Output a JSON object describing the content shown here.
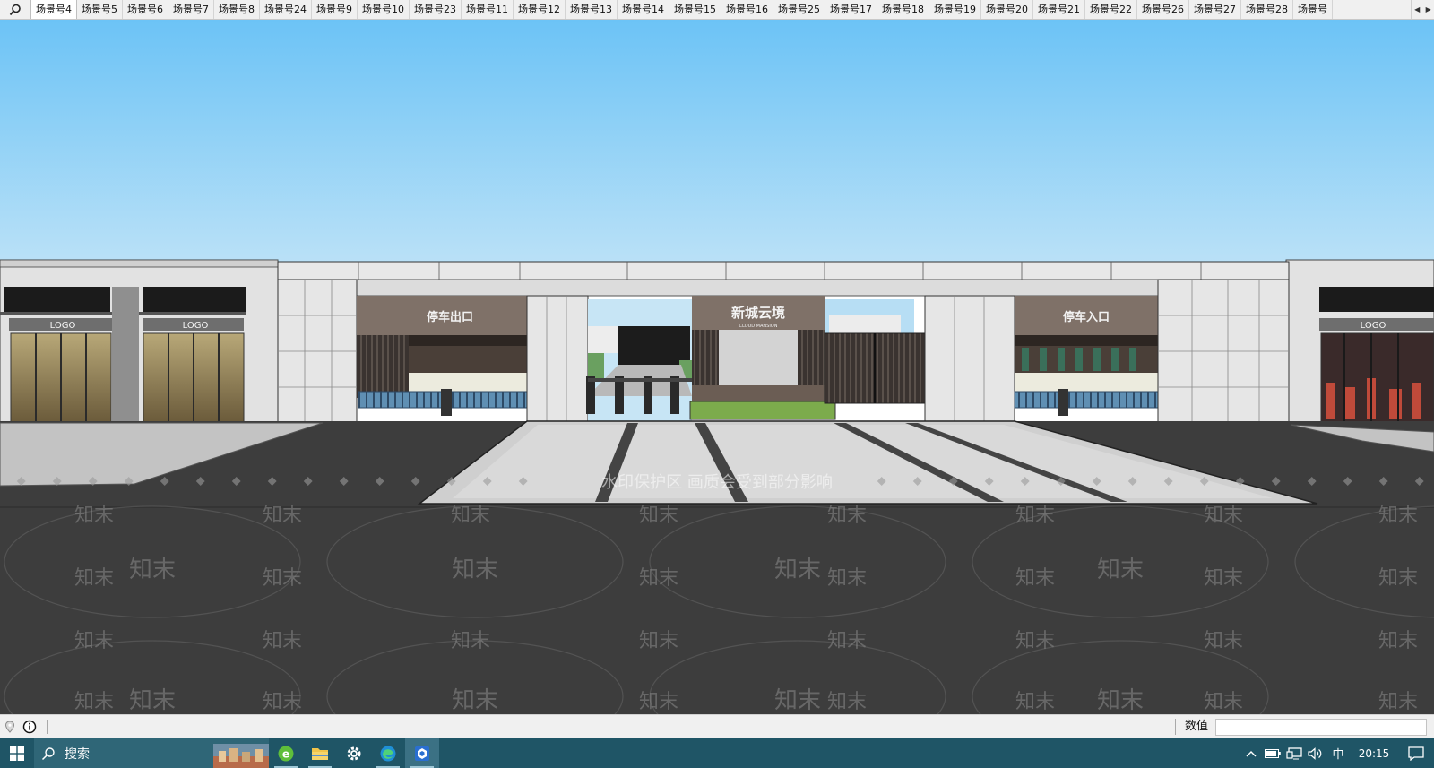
{
  "scene_tabs": {
    "active_index": 0,
    "items": [
      "场景号4",
      "场景号5",
      "场景号6",
      "场景号7",
      "场景号8",
      "场景号24",
      "场景号9",
      "场景号10",
      "场景号23",
      "场景号11",
      "场景号12",
      "场景号13",
      "场景号14",
      "场景号15",
      "场景号16",
      "场景号25",
      "场景号17",
      "场景号18",
      "场景号19",
      "场景号20",
      "场景号21",
      "场景号22",
      "场景号26",
      "场景号27",
      "场景号28",
      "场景号"
    ]
  },
  "scene": {
    "sign_exit": "停车出口",
    "sign_main": "新城云境",
    "sign_main_sub": "CLOUD MANSION",
    "sign_entry": "停车入口",
    "shop_logo_1": "LOGO",
    "shop_logo_2": "LOGO",
    "shop_logo_3": "LOGO",
    "watermark_notice": "水印保护区  画质会受到部分影响",
    "watermark_text": "知末"
  },
  "status_bar": {
    "measure_label": "数值",
    "measure_value": ""
  },
  "taskbar": {
    "search_placeholder": "搜索",
    "ime": "中",
    "clock": "20:15"
  },
  "colors": {
    "sky_top": "#6cc3f6",
    "sky_bottom": "#bfe3f7",
    "asphalt": "#3d3d3d",
    "taskbar": "#1f5566"
  }
}
